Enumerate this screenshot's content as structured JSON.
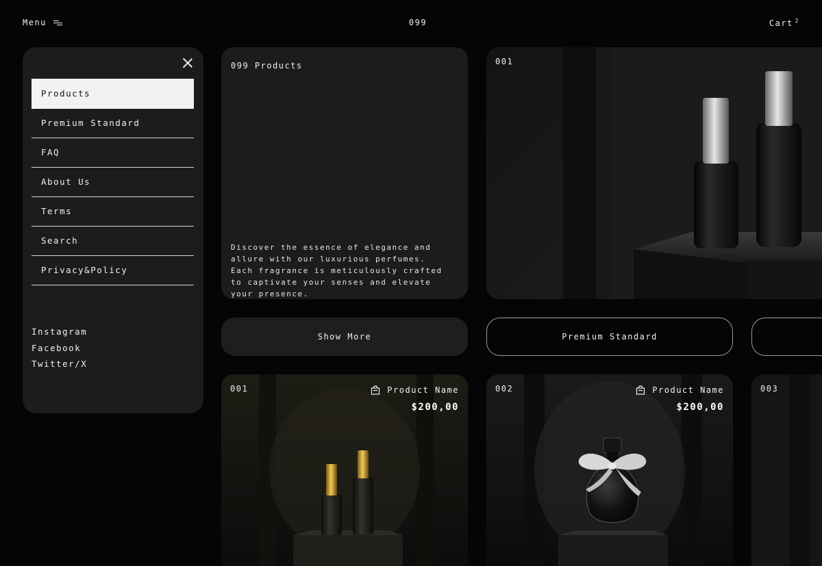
{
  "topbar": {
    "menu_label": "Menu",
    "brand": "099",
    "cart_label": "Cart",
    "cart_count": "2"
  },
  "side_menu": {
    "items": [
      {
        "label": "Products",
        "active": true
      },
      {
        "label": "Premium Standard"
      },
      {
        "label": "FAQ"
      },
      {
        "label": "About Us"
      },
      {
        "label": "Terms"
      },
      {
        "label": "Search"
      },
      {
        "label": "Privacy&Policy"
      }
    ],
    "socials": [
      "Instagram",
      "Facebook",
      "Twitter/X"
    ]
  },
  "intro": {
    "title": "099 Products",
    "description": "Discover the essence of elegance and allure with our luxurious perfumes. Each fragrance is meticulously crafted to captivate your senses and elevate your presence."
  },
  "hero": {
    "number": "001"
  },
  "buttons": {
    "show_more": "Show More",
    "premium": "Premium Standard"
  },
  "products": [
    {
      "number": "001",
      "name": "Product Name",
      "price": "$200,00"
    },
    {
      "number": "002",
      "name": "Product Name",
      "price": "$200,00"
    },
    {
      "number": "003"
    }
  ],
  "icons": {
    "menu": "menu-lines-icon",
    "close": "close-icon",
    "bag": "shopping-bag-icon"
  },
  "colors": {
    "background": "#050505",
    "panel": "#1c1c1c",
    "active_item": "#f4f2f0",
    "gold": "#c9a13a",
    "silver": "#bdbdbd"
  }
}
